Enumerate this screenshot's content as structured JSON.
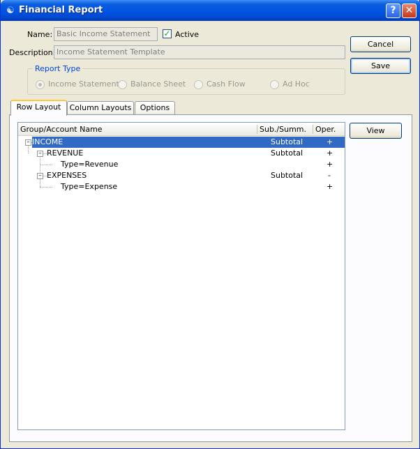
{
  "window": {
    "title": "Financial Report"
  },
  "form": {
    "name_label": "Name:",
    "name_value": "Basic Income Statement",
    "active_label": "Active",
    "active_checked": true,
    "description_label": "Description:",
    "description_value": "Income Statement Template"
  },
  "buttons": {
    "cancel": "Cancel",
    "save": "Save",
    "view": "View"
  },
  "report_type": {
    "title": "Report Type",
    "options": [
      "Income Statement",
      "Balance Sheet",
      "Cash Flow",
      "Ad Hoc"
    ],
    "selected": "Income Statement"
  },
  "tabs": [
    "Row Layout",
    "Column Layouts",
    "Options"
  ],
  "active_tab": "Row Layout",
  "tree": {
    "columns": [
      "Group/Account Name",
      "Sub./Summ.",
      "Oper."
    ],
    "rows": [
      {
        "name": "INCOME",
        "sub": "Subtotal",
        "oper": "+",
        "selected": true
      },
      {
        "name": "REVENUE",
        "sub": "Subtotal",
        "oper": "+"
      },
      {
        "name": "Type=Revenue",
        "sub": "",
        "oper": "+"
      },
      {
        "name": "EXPENSES",
        "sub": "Subtotal",
        "oper": "-"
      },
      {
        "name": "Type=Expense",
        "sub": "",
        "oper": "+"
      }
    ]
  },
  "colors": {
    "title_bar": "#0054e3",
    "selection": "#316ac5",
    "group_title": "#0046d5"
  }
}
